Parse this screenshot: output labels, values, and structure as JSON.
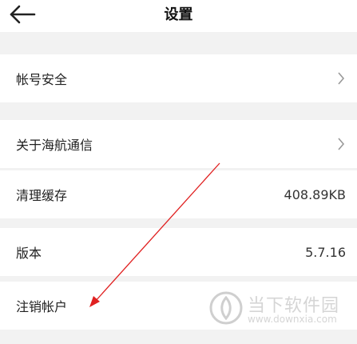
{
  "header": {
    "title": "设置",
    "back_icon": "arrow-left-icon"
  },
  "rows": [
    {
      "label": "帐号安全",
      "value": "",
      "has_chevron": true
    },
    {
      "label": "关于海航通信",
      "value": "",
      "has_chevron": true
    },
    {
      "label": "清理缓存",
      "value": "408.89KB",
      "has_chevron": false
    },
    {
      "label": "版本",
      "value": "5.7.16",
      "has_chevron": false
    },
    {
      "label": "注销帐户",
      "value": "",
      "has_chevron": false
    }
  ],
  "annotation": {
    "color": "#e02020"
  },
  "watermark": {
    "name": "当下软件园",
    "url": "www.downxia.com"
  }
}
